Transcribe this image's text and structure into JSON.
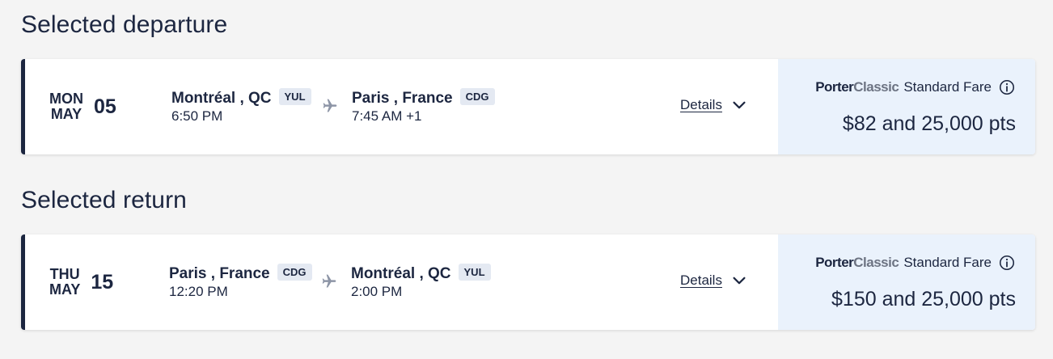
{
  "departure": {
    "section_title": "Selected departure",
    "date": {
      "weekday": "MON",
      "month": "MAY",
      "day": "05"
    },
    "origin": {
      "city": "Montréal , QC",
      "code": "YUL",
      "time": "6:50 PM"
    },
    "destination": {
      "city": "Paris , France",
      "code": "CDG",
      "time": "7:45 AM +1"
    },
    "details_label": "Details",
    "fare": {
      "brand_part1": "Porter",
      "brand_part2": "Classic",
      "fare_type": "Standard Fare",
      "price": "$82 and 25,000 pts"
    }
  },
  "return": {
    "section_title": "Selected return",
    "date": {
      "weekday": "THU",
      "month": "MAY",
      "day": "15"
    },
    "origin": {
      "city": "Paris , France",
      "code": "CDG",
      "time": "12:20 PM"
    },
    "destination": {
      "city": "Montréal , QC",
      "code": "YUL",
      "time": "2:00 PM"
    },
    "details_label": "Details",
    "fare": {
      "brand_part1": "Porter",
      "brand_part2": "Classic",
      "fare_type": "Standard Fare",
      "price": "$150 and 25,000 pts"
    }
  },
  "icons": {
    "plane": "airplane-icon",
    "chevron": "chevron-down-icon",
    "info": "info-circle-icon"
  },
  "colors": {
    "primary": "#1c2640",
    "fare_panel": "#eaf2fc",
    "code_badge": "#e4e9f2",
    "plane_icon": "#8d95a6",
    "background": "#f4f4f4"
  }
}
